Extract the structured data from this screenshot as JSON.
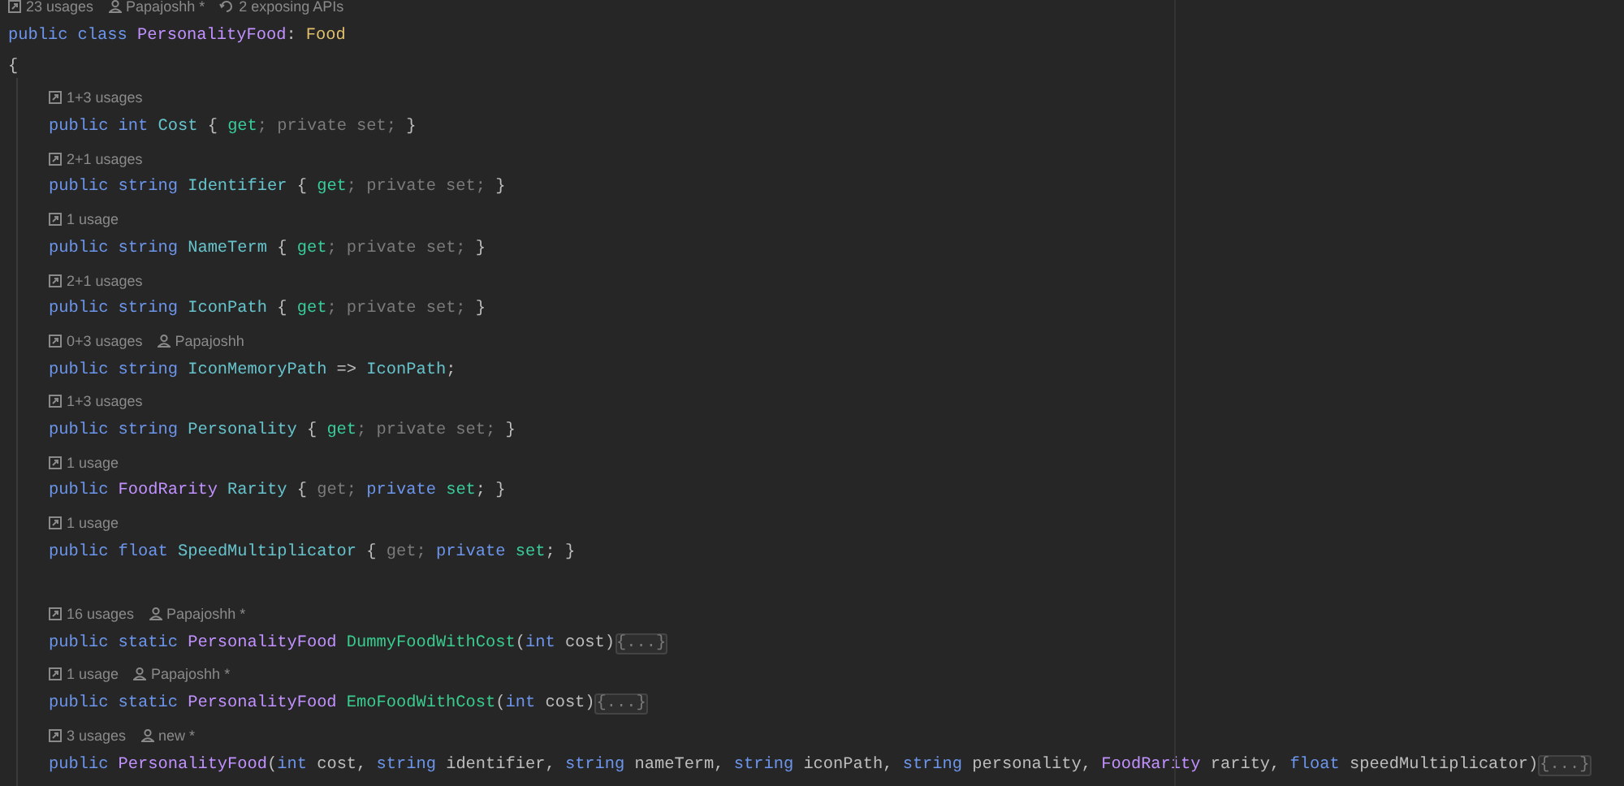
{
  "class": {
    "hints": [
      {
        "kind": "usages",
        "text": "23 usages"
      },
      {
        "kind": "author",
        "text": "Papajoshh *"
      },
      {
        "kind": "apis",
        "text": "2 exposing APIs"
      }
    ],
    "declaration": [
      {
        "kind": "keyword",
        "text": "public class "
      },
      {
        "kind": "type",
        "text": "PersonalityFood"
      },
      {
        "kind": "plain",
        "text": ": "
      },
      {
        "kind": "base",
        "text": "Food"
      }
    ],
    "open_brace": "{",
    "properties": [
      {
        "hints": [
          {
            "kind": "usages",
            "text": "1+3 usages"
          }
        ],
        "code": [
          {
            "kind": "keyword",
            "text": "public int "
          },
          {
            "kind": "property",
            "text": "Cost"
          },
          {
            "kind": "plain",
            "text": " { "
          },
          {
            "kind": "accessor",
            "text": "get"
          },
          {
            "kind": "muted",
            "text": "; private set; "
          },
          {
            "kind": "plain",
            "text": "}"
          }
        ]
      },
      {
        "hints": [
          {
            "kind": "usages",
            "text": "2+1 usages"
          }
        ],
        "code": [
          {
            "kind": "keyword",
            "text": "public string "
          },
          {
            "kind": "property",
            "text": "Identifier"
          },
          {
            "kind": "plain",
            "text": " { "
          },
          {
            "kind": "accessor",
            "text": "get"
          },
          {
            "kind": "muted",
            "text": "; private set; "
          },
          {
            "kind": "plain",
            "text": "}"
          }
        ]
      },
      {
        "hints": [
          {
            "kind": "usages",
            "text": "1 usage"
          }
        ],
        "code": [
          {
            "kind": "keyword",
            "text": "public string "
          },
          {
            "kind": "property",
            "text": "NameTerm"
          },
          {
            "kind": "plain",
            "text": " { "
          },
          {
            "kind": "accessor",
            "text": "get"
          },
          {
            "kind": "muted",
            "text": "; private set; "
          },
          {
            "kind": "plain",
            "text": "}"
          }
        ]
      },
      {
        "hints": [
          {
            "kind": "usages",
            "text": "2+1 usages"
          }
        ],
        "code": [
          {
            "kind": "keyword",
            "text": "public string "
          },
          {
            "kind": "property",
            "text": "IconPath"
          },
          {
            "kind": "plain",
            "text": " { "
          },
          {
            "kind": "accessor",
            "text": "get"
          },
          {
            "kind": "muted",
            "text": "; private set; "
          },
          {
            "kind": "plain",
            "text": "}"
          }
        ]
      },
      {
        "hints": [
          {
            "kind": "usages",
            "text": "0+3 usages"
          },
          {
            "kind": "author",
            "text": "Papajoshh"
          }
        ],
        "code": [
          {
            "kind": "keyword",
            "text": "public string "
          },
          {
            "kind": "property",
            "text": "IconMemoryPath"
          },
          {
            "kind": "plain",
            "text": " => "
          },
          {
            "kind": "property",
            "text": "IconPath"
          },
          {
            "kind": "plain",
            "text": ";"
          }
        ]
      },
      {
        "hints": [
          {
            "kind": "usages",
            "text": "1+3 usages"
          }
        ],
        "code": [
          {
            "kind": "keyword",
            "text": "public string "
          },
          {
            "kind": "property",
            "text": "Personality"
          },
          {
            "kind": "plain",
            "text": " { "
          },
          {
            "kind": "accessor",
            "text": "get"
          },
          {
            "kind": "muted",
            "text": "; private set; "
          },
          {
            "kind": "plain",
            "text": "}"
          }
        ]
      },
      {
        "hints": [
          {
            "kind": "usages",
            "text": "1 usage"
          }
        ],
        "code": [
          {
            "kind": "keyword",
            "text": "public "
          },
          {
            "kind": "type",
            "text": "FoodRarity "
          },
          {
            "kind": "property",
            "text": "Rarity"
          },
          {
            "kind": "plain",
            "text": " { "
          },
          {
            "kind": "muted",
            "text": "get; "
          },
          {
            "kind": "keyword",
            "text": "private "
          },
          {
            "kind": "accessor",
            "text": "set"
          },
          {
            "kind": "plain",
            "text": "; }"
          }
        ]
      },
      {
        "hints": [
          {
            "kind": "usages",
            "text": "1 usage"
          }
        ],
        "code": [
          {
            "kind": "keyword",
            "text": "public float "
          },
          {
            "kind": "property",
            "text": "SpeedMultiplicator"
          },
          {
            "kind": "plain",
            "text": " { "
          },
          {
            "kind": "muted",
            "text": "get; "
          },
          {
            "kind": "keyword",
            "text": "private "
          },
          {
            "kind": "accessor",
            "text": "set"
          },
          {
            "kind": "plain",
            "text": "; }"
          }
        ]
      }
    ],
    "methods": [
      {
        "hints": [
          {
            "kind": "usages",
            "text": "16 usages"
          },
          {
            "kind": "author",
            "text": "Papajoshh *"
          }
        ],
        "code": [
          {
            "kind": "keyword",
            "text": "public static "
          },
          {
            "kind": "type",
            "text": "PersonalityFood "
          },
          {
            "kind": "method",
            "text": "DummyFoodWithCost"
          },
          {
            "kind": "plain",
            "text": "("
          },
          {
            "kind": "keyword",
            "text": "int "
          },
          {
            "kind": "plain",
            "text": "cost)"
          },
          {
            "kind": "fold",
            "text": "{...}"
          }
        ]
      },
      {
        "hints": [
          {
            "kind": "usages",
            "text": "1 usage"
          },
          {
            "kind": "author",
            "text": "Papajoshh *"
          }
        ],
        "code": [
          {
            "kind": "keyword",
            "text": "public static "
          },
          {
            "kind": "type",
            "text": "PersonalityFood "
          },
          {
            "kind": "method",
            "text": "EmoFoodWithCost"
          },
          {
            "kind": "plain",
            "text": "("
          },
          {
            "kind": "keyword",
            "text": "int "
          },
          {
            "kind": "plain",
            "text": "cost)"
          },
          {
            "kind": "fold",
            "text": "{...}"
          }
        ]
      },
      {
        "hints": [
          {
            "kind": "usages",
            "text": "3 usages"
          },
          {
            "kind": "author",
            "text": "new *"
          }
        ],
        "code": [
          {
            "kind": "keyword",
            "text": "public "
          },
          {
            "kind": "type",
            "text": "PersonalityFood"
          },
          {
            "kind": "plain",
            "text": "("
          },
          {
            "kind": "keyword",
            "text": "int "
          },
          {
            "kind": "plain",
            "text": "cost, "
          },
          {
            "kind": "keyword",
            "text": "string "
          },
          {
            "kind": "plain",
            "text": "identifier, "
          },
          {
            "kind": "keyword",
            "text": "string "
          },
          {
            "kind": "plain",
            "text": "nameTerm, "
          },
          {
            "kind": "keyword",
            "text": "string "
          },
          {
            "kind": "plain",
            "text": "iconPath, "
          },
          {
            "kind": "keyword",
            "text": "string "
          },
          {
            "kind": "plain",
            "text": "personality, "
          },
          {
            "kind": "type",
            "text": "FoodRarity "
          },
          {
            "kind": "plain",
            "text": "rarity, "
          },
          {
            "kind": "keyword",
            "text": "float "
          },
          {
            "kind": "plain",
            "text": "speedMultiplicator)"
          },
          {
            "kind": "fold",
            "text": "{...}"
          }
        ]
      }
    ]
  }
}
